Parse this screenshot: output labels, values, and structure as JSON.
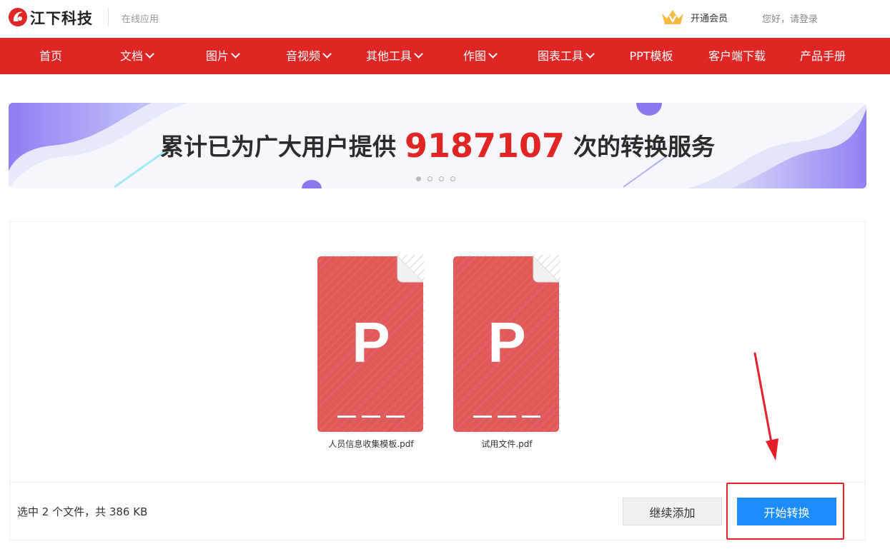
{
  "header": {
    "brand": "江下科技",
    "subtitle": "在线应用",
    "vip_label": "开通会员",
    "login_label": "您好，请登录"
  },
  "nav": {
    "items": [
      {
        "label": "首页",
        "dropdown": false
      },
      {
        "label": "文档",
        "dropdown": true
      },
      {
        "label": "图片",
        "dropdown": true
      },
      {
        "label": "音视频",
        "dropdown": true
      },
      {
        "label": "其他工具",
        "dropdown": true
      },
      {
        "label": "作图",
        "dropdown": true
      },
      {
        "label": "图表工具",
        "dropdown": true
      },
      {
        "label": "PPT模板",
        "dropdown": false
      },
      {
        "label": "客户端下载",
        "dropdown": false
      },
      {
        "label": "产品手册",
        "dropdown": false
      }
    ]
  },
  "banner": {
    "prefix": "累计已为广大用户提供",
    "count": "9187107",
    "suffix": "次的转换服务",
    "slide_count": 4,
    "active_slide": 1
  },
  "files": [
    {
      "letter": "P",
      "name": "人员信息收集模板.pdf"
    },
    {
      "letter": "P",
      "name": "试用文件.pdf"
    }
  ],
  "footer": {
    "summary": "选中 2 个文件，共 386 KB",
    "add_label": "继续添加",
    "start_label": "开始转换"
  },
  "colors": {
    "brand_red": "#e02525",
    "file_red": "#e05a5a",
    "primary_blue": "#1a8cff",
    "annotation_red": "#e5202b"
  },
  "icons": {
    "logo": "jiangxia-logo-icon",
    "vip": "crown-icon",
    "dropdown": "chevron-down-icon",
    "file": "pdf-file-icon"
  }
}
